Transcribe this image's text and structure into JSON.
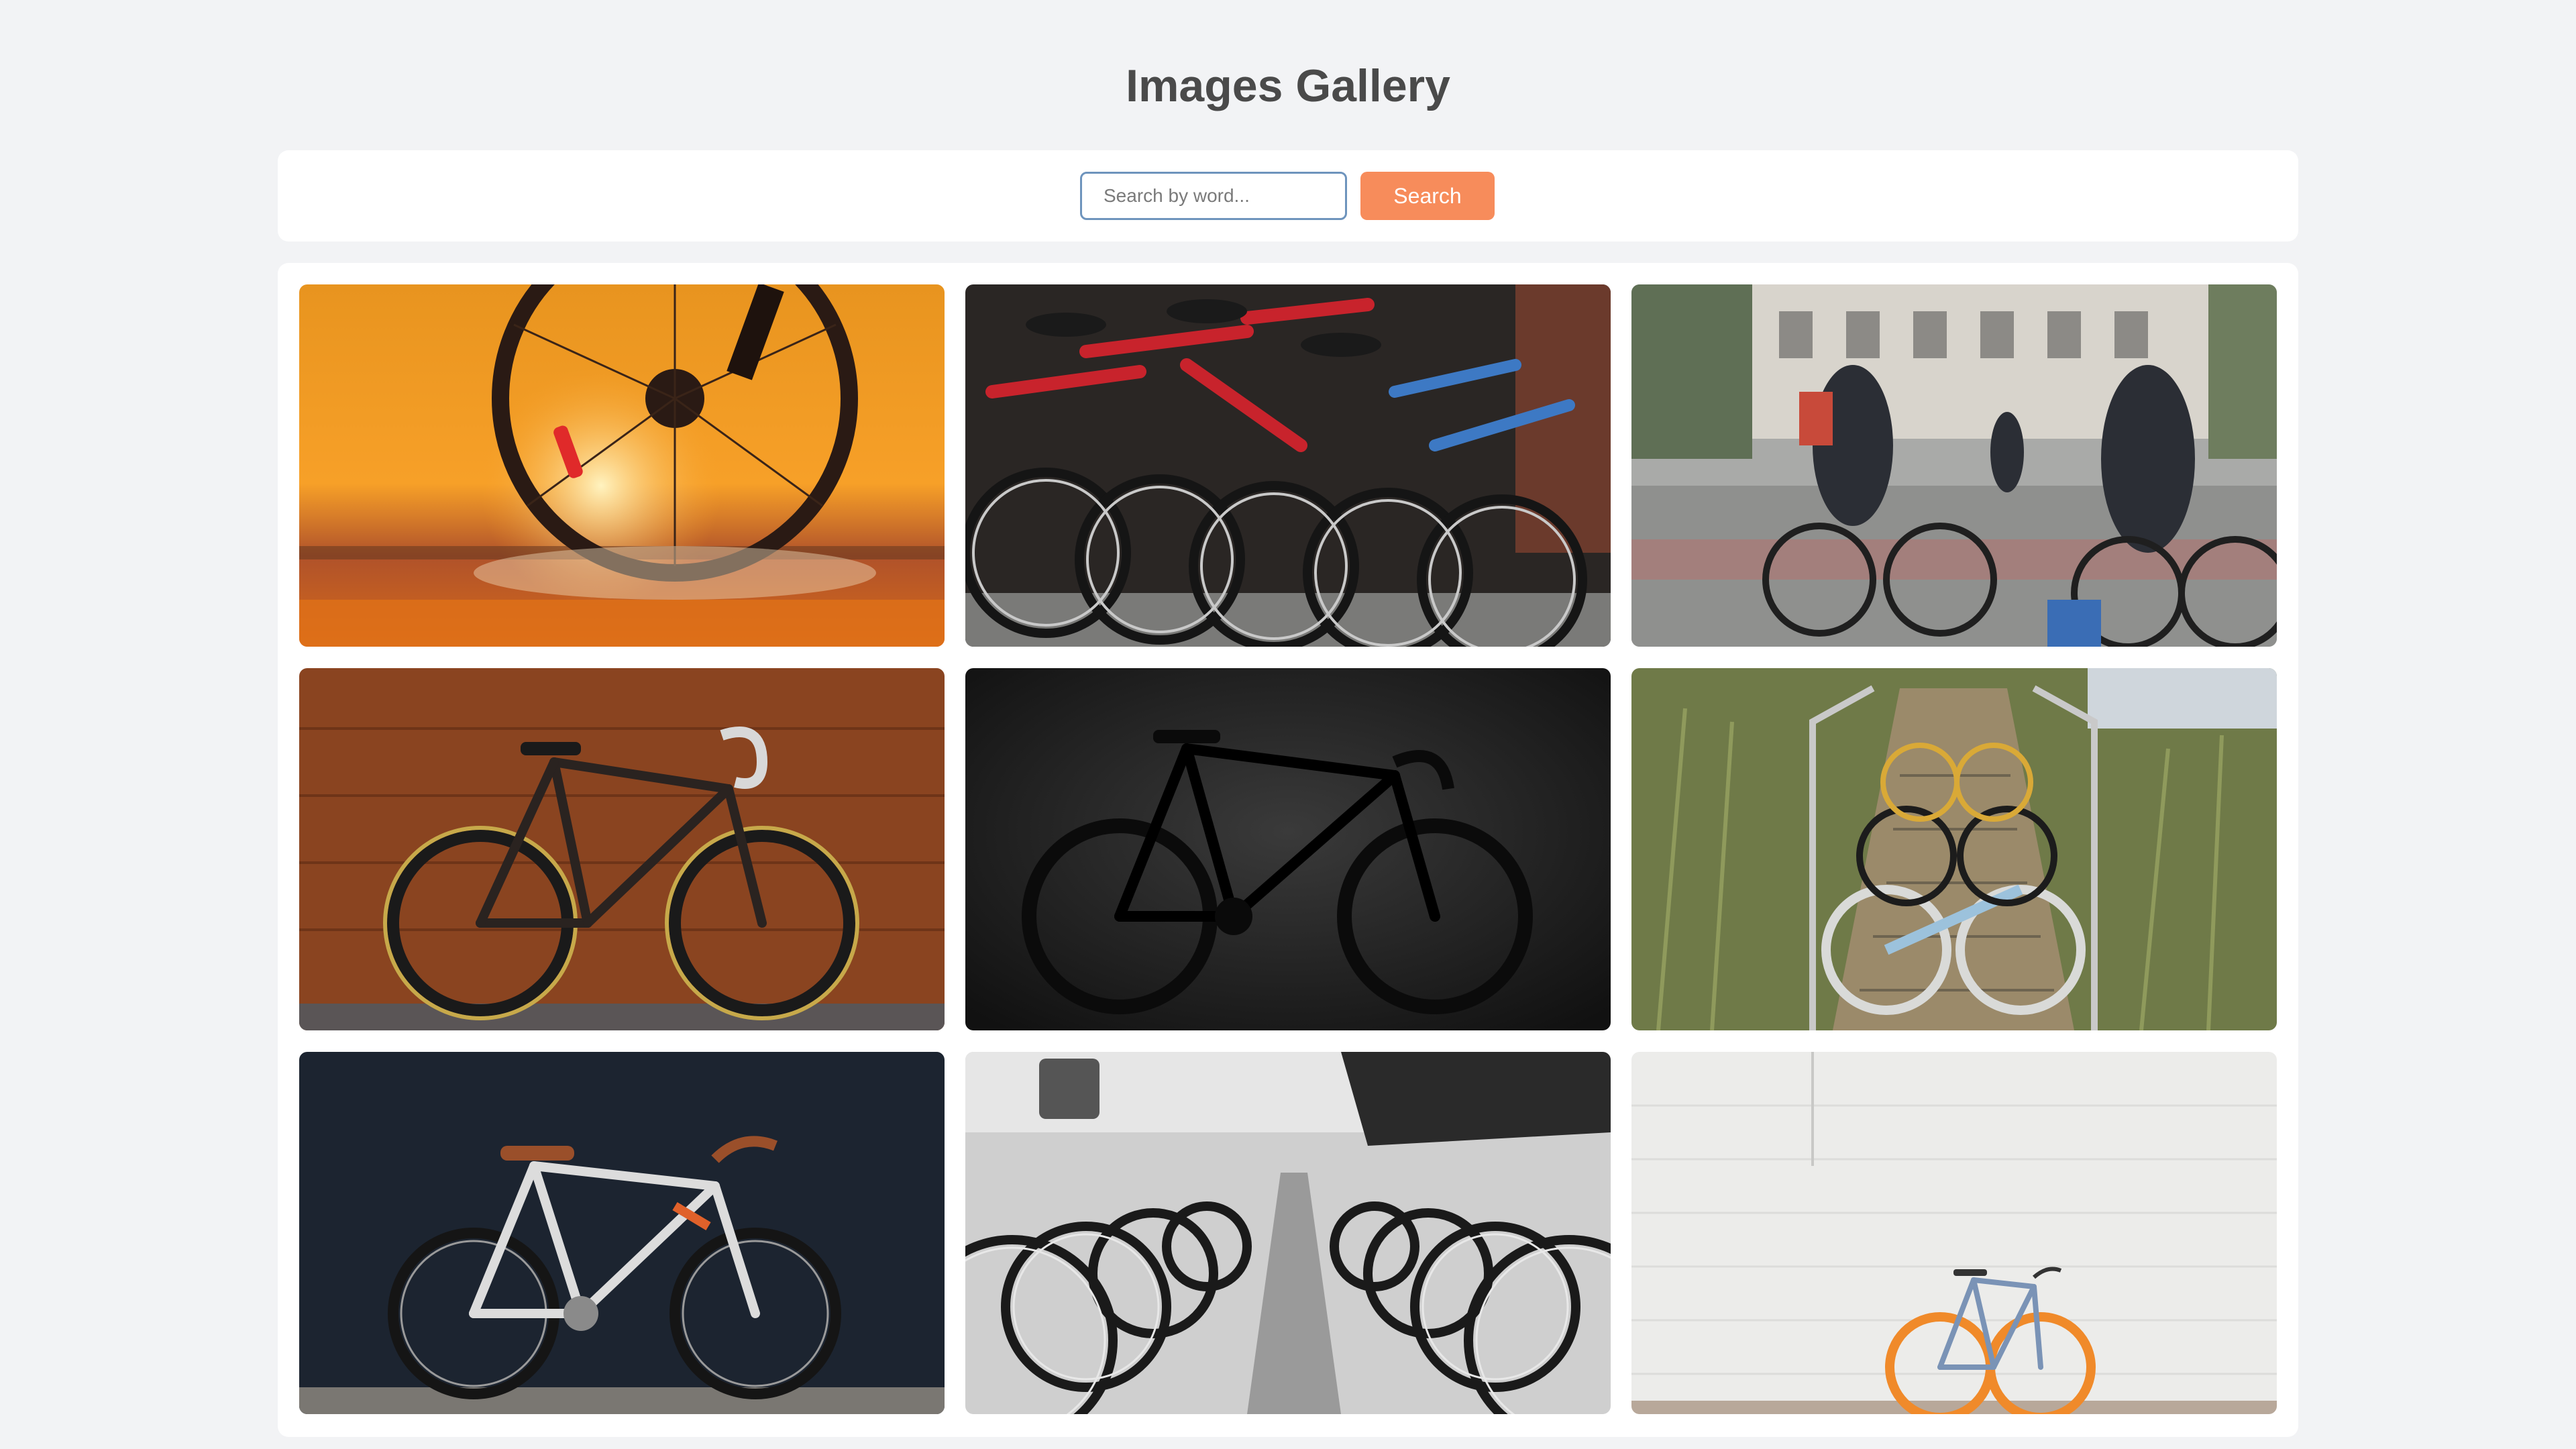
{
  "header": {
    "title": "Images Gallery"
  },
  "search": {
    "placeholder": "Search by word...",
    "value": "",
    "button_label": "Search"
  },
  "colors": {
    "background": "#f2f3f5",
    "card": "#ffffff",
    "accent": "#f78c5b",
    "input_border": "#6e94bd",
    "title": "#4a4a4a"
  },
  "gallery": {
    "images": [
      {
        "subject": "bicycle-wheel-sunset-splash"
      },
      {
        "subject": "parked-red-and-blue-bicycles"
      },
      {
        "subject": "city-cyclists-motion-blur"
      },
      {
        "subject": "road-bike-wooden-wall"
      },
      {
        "subject": "black-road-bike-dark-studio"
      },
      {
        "subject": "three-bikes-on-stairs-grass"
      },
      {
        "subject": "white-fixie-dark-wall"
      },
      {
        "subject": "black-white-bike-rows"
      },
      {
        "subject": "blue-bike-orange-rims-white-wall"
      }
    ]
  }
}
